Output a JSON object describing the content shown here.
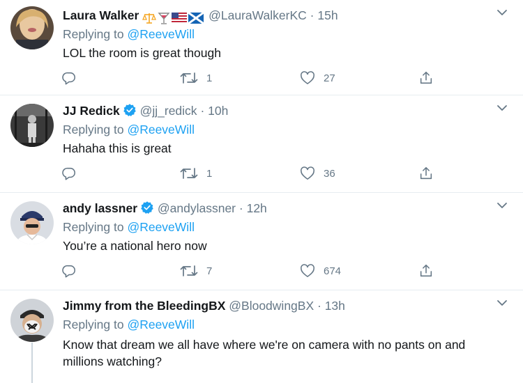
{
  "tweets": [
    {
      "name": "Laura Walker",
      "handle": "@LauraWalkerKC",
      "time": "15h",
      "verified": false,
      "emojis": [
        "scales-emoji",
        "cocktail-emoji",
        "us-flag-emoji",
        "scotland-flag-emoji"
      ],
      "replying_prefix": "Replying to",
      "replying_to": "@ReeveWill",
      "text": "LOL the room is great though",
      "retweets": "1",
      "likes": "27"
    },
    {
      "name": "JJ Redick",
      "handle": "@jj_redick",
      "time": "10h",
      "verified": true,
      "replying_prefix": "Replying to",
      "replying_to": "@ReeveWill",
      "text": "Hahaha this is great",
      "retweets": "1",
      "likes": "36"
    },
    {
      "name": "andy lassner",
      "handle": "@andylassner",
      "time": "12h",
      "verified": true,
      "replying_prefix": "Replying to",
      "replying_to": "@ReeveWill",
      "text": "You’re a national hero now",
      "retweets": "7",
      "likes": "674"
    },
    {
      "name": "Jimmy from the BleedingBX",
      "handle": "@BloodwingBX",
      "time": "13h",
      "verified": false,
      "replying_prefix": "Replying to",
      "replying_to": "@ReeveWill",
      "text": "Know that dream we all have where we're on camera with no pants on and millions watching?"
    }
  ],
  "separator": "·",
  "colors": {
    "accent": "#1da1f2",
    "secondary_text": "#657786",
    "primary_text": "#14171a",
    "divider": "#e6ecf0"
  }
}
